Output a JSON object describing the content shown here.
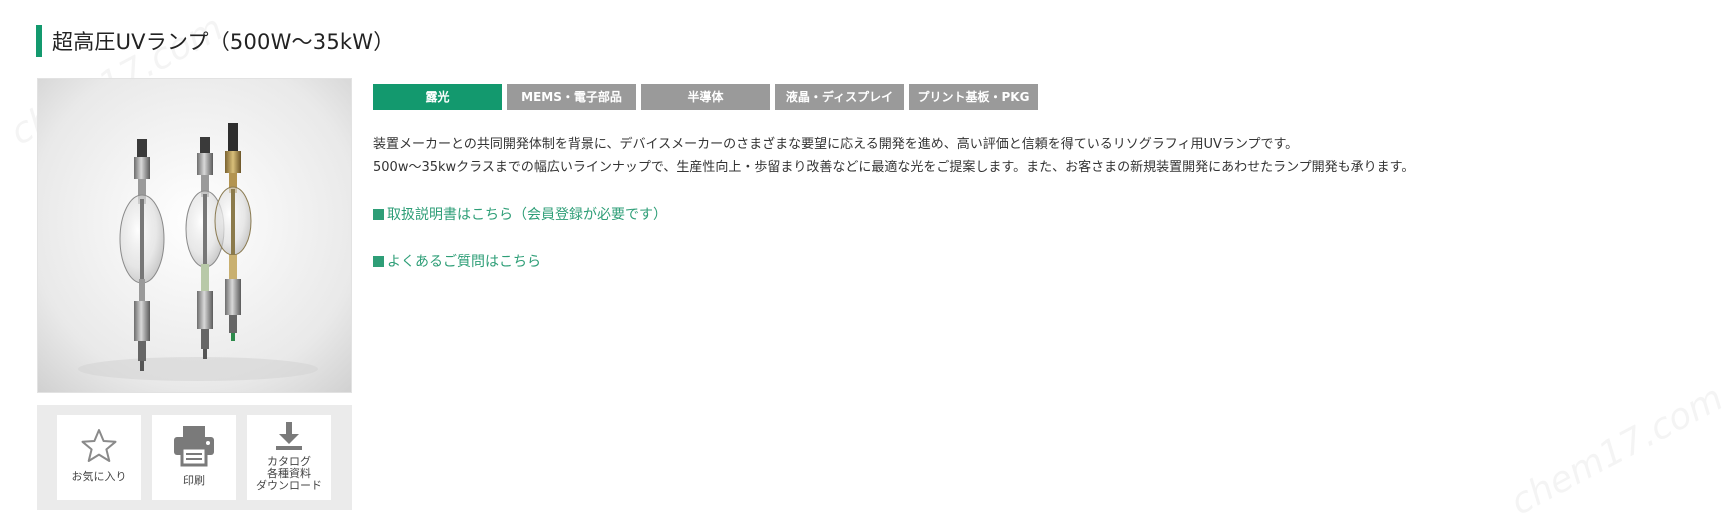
{
  "colors": {
    "accent": "#13996e",
    "link": "#2e9e77",
    "tag_inactive": "#9a9a9a",
    "panel_bg": "#ebebeb"
  },
  "header": {
    "title": "超高圧UVランプ（500W〜35kW）"
  },
  "actions": [
    {
      "label": "お気に入り",
      "icon": "star-icon"
    },
    {
      "label": "印刷",
      "icon": "printer-icon"
    },
    {
      "label": "カタログ\n各種資料\nダウンロード",
      "icon": "download-icon"
    }
  ],
  "tags": [
    {
      "label": "露光",
      "active": true
    },
    {
      "label": "MEMS・電子部品",
      "active": false
    },
    {
      "label": "半導体",
      "active": false
    },
    {
      "label": "液晶・ディスプレイ",
      "active": false
    },
    {
      "label": "プリント基板・PKG",
      "active": false
    }
  ],
  "description": {
    "line1": "装置メーカーとの共同開発体制を背景に、デバイスメーカーのさまざまな要望に応える開発を進め、高い評価と信頼を得ているリソグラフィ用UVランプです。",
    "line2": "500w〜35kwクラスまでの幅広いラインナップで、生産性向上・歩留まり改善などに最適な光をご提案します。また、お客さまの新規装置開発にあわせたランプ開発も承ります。"
  },
  "links": {
    "manual": "取扱説明書はこちら（会員登録が必要です）",
    "faq": "よくあるご質問はこちら"
  },
  "watermark": {
    "text": "chem17.com"
  }
}
